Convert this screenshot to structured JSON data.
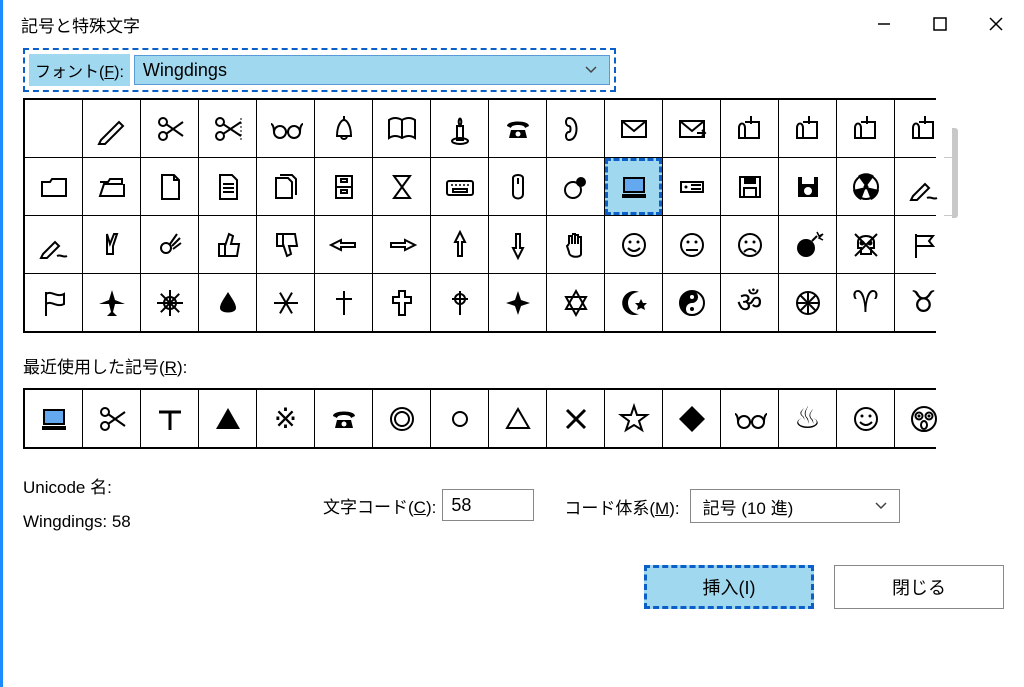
{
  "title": "記号と特殊文字",
  "font_label_pre": "フォント(",
  "font_label_key": "F",
  "font_label_post": "):",
  "font_value": "Wingdings",
  "recent_label_pre": "最近使用した記号(",
  "recent_label_key": "R",
  "recent_label_post": "):",
  "unicode_name_label": "Unicode 名:",
  "font_charname": "Wingdings: 58",
  "char_code_label_pre": "文字コード(",
  "char_code_label_key": "C",
  "char_code_label_post": "):",
  "char_code_value": "58",
  "code_system_label_pre": "コード体系(",
  "code_system_label_key": "M",
  "code_system_label_post": "):",
  "code_system_value": "記号 (10 進)",
  "insert_label": "挿入(I)",
  "close_label": "閉じる",
  "grid": [
    [
      "",
      "pencil",
      "scissors",
      "scissors-cut",
      "glasses",
      "bell",
      "book",
      "candle",
      "phone",
      "handset",
      "envelope",
      "envelope-arrow",
      "mailbox",
      "mailbox-flag",
      "mailbox-open",
      "mailbox-open2"
    ],
    [
      "folder",
      "folder-open",
      "document",
      "document-text",
      "documents",
      "file-cabinet",
      "hourglass",
      "keyboard",
      "mouse",
      "trackball",
      "computer",
      "hdd",
      "floppy",
      "floppy2",
      "radiation",
      "write"
    ],
    [
      "write2",
      "victory",
      "ok-hand",
      "thumbs-up",
      "thumbs-down",
      "point-left",
      "point-right",
      "point-up",
      "point-down",
      "hand-stop",
      "smile",
      "neutral",
      "frown",
      "bomb",
      "skull",
      "flag"
    ],
    [
      "flag-wave",
      "airplane",
      "sun",
      "droplet",
      "snowflake",
      "cross",
      "cross-outline",
      "celtic-cross",
      "maltese-cross",
      "star-david",
      "crescent",
      "yin-yang",
      "om",
      "wheel",
      "aries",
      "taurus"
    ]
  ],
  "recent": [
    "computer",
    "scissors",
    "tee",
    "triangle-up-fill",
    "reference",
    "phone",
    "circle-double",
    "circle-small",
    "triangle-up",
    "multiply",
    "star",
    "diamond-fill",
    "glasses",
    "hotspring",
    "smile",
    "flushed"
  ],
  "selected": {
    "row": 1,
    "col": 10
  }
}
